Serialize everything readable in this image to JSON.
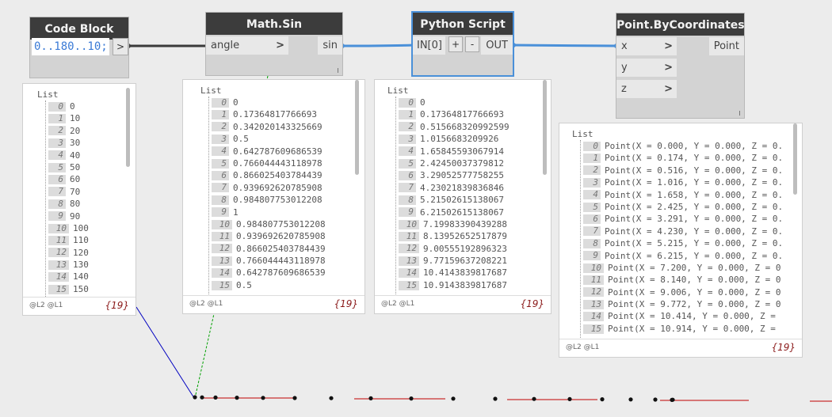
{
  "nodes": {
    "code_block": {
      "title": "Code Block",
      "code": "0..180..10;",
      "output_chevron": ">",
      "preview": {
        "list_label": "List",
        "indices": [
          "0",
          "1",
          "2",
          "3",
          "4",
          "5",
          "6",
          "7",
          "8",
          "9",
          "10",
          "11",
          "12",
          "13",
          "14",
          "15"
        ],
        "values": [
          "0",
          "10",
          "20",
          "30",
          "40",
          "50",
          "60",
          "70",
          "80",
          "90",
          "100",
          "110",
          "120",
          "130",
          "140",
          "150"
        ],
        "levels": "@L2 @L1",
        "count": "{19}"
      }
    },
    "math_sin": {
      "title": "Math.Sin",
      "input_label": "angle",
      "input_chevron": ">",
      "output_label": "sin",
      "preview": {
        "list_label": "List",
        "indices": [
          "0",
          "1",
          "2",
          "3",
          "4",
          "5",
          "6",
          "7",
          "8",
          "9",
          "10",
          "11",
          "12",
          "13",
          "14",
          "15"
        ],
        "values": [
          "0",
          "0.17364817766693",
          "0.342020143325669",
          "0.5",
          "0.642787609686539",
          "0.766044443118978",
          "0.866025403784439",
          "0.939692620785908",
          "0.984807753012208",
          "1",
          "0.984807753012208",
          "0.939692620785908",
          "0.866025403784439",
          "0.766044443118978",
          "0.642787609686539",
          "0.5"
        ],
        "levels": "@L2 @L1",
        "count": "{19}"
      }
    },
    "python_script": {
      "title": "Python Script",
      "input_label": "IN[0]",
      "add_label": "+",
      "remove_label": "-",
      "output_label": "OUT",
      "preview": {
        "list_label": "List",
        "indices": [
          "0",
          "1",
          "2",
          "3",
          "4",
          "5",
          "6",
          "7",
          "8",
          "9",
          "10",
          "11",
          "12",
          "13",
          "14",
          "15"
        ],
        "values": [
          "0",
          "0.17364817766693",
          "0.515668320992599",
          "1.0156683209926",
          "1.65845593067914",
          "2.42450037379812",
          "3.29052577758255",
          "4.23021839836846",
          "5.21502615138067",
          "6.21502615138067",
          "7.19983390439288",
          "8.13952652517879",
          "9.00555192896323",
          "9.77159637208221",
          "10.4143839817687",
          "10.9143839817687"
        ],
        "levels": "@L2 @L1",
        "count": "{19}"
      }
    },
    "point_by_coordinates": {
      "title": "Point.ByCoordinates",
      "inputs": [
        "x",
        "y",
        "z"
      ],
      "input_chevron": ">",
      "output_label": "Point",
      "preview": {
        "list_label": "List",
        "indices": [
          "0",
          "1",
          "2",
          "3",
          "4",
          "5",
          "6",
          "7",
          "8",
          "9",
          "10",
          "11",
          "12",
          "13",
          "14",
          "15"
        ],
        "values": [
          "Point(X = 0.000, Y = 0.000, Z = 0.",
          "Point(X = 0.174, Y = 0.000, Z = 0.",
          "Point(X = 0.516, Y = 0.000, Z = 0.",
          "Point(X = 1.016, Y = 0.000, Z = 0.",
          "Point(X = 1.658, Y = 0.000, Z = 0.",
          "Point(X = 2.425, Y = 0.000, Z = 0.",
          "Point(X = 3.291, Y = 0.000, Z = 0.",
          "Point(X = 4.230, Y = 0.000, Z = 0.",
          "Point(X = 5.215, Y = 0.000, Z = 0.",
          "Point(X = 6.215, Y = 0.000, Z = 0.",
          "Point(X = 7.200, Y = 0.000, Z = 0",
          "Point(X = 8.140, Y = 0.000, Z = 0",
          "Point(X = 9.006, Y = 0.000, Z = 0",
          "Point(X = 9.772, Y = 0.000, Z = 0",
          "Point(X = 10.414, Y = 0.000, Z =",
          "Point(X = 10.914, Y = 0.000, Z ="
        ],
        "levels": "@L2 @L1",
        "count": "{19}"
      }
    }
  },
  "colors": {
    "title_bar": "#3c3c3c",
    "wire_default": "#3a3a3a",
    "wire_selected": "#4a90d9",
    "count_text": "#8b1a1a",
    "code_text": "#3b7bd6",
    "background_axis_x": "#c00000",
    "background_axis_y": "#00a000",
    "background_axis_z": "#0000c0"
  }
}
